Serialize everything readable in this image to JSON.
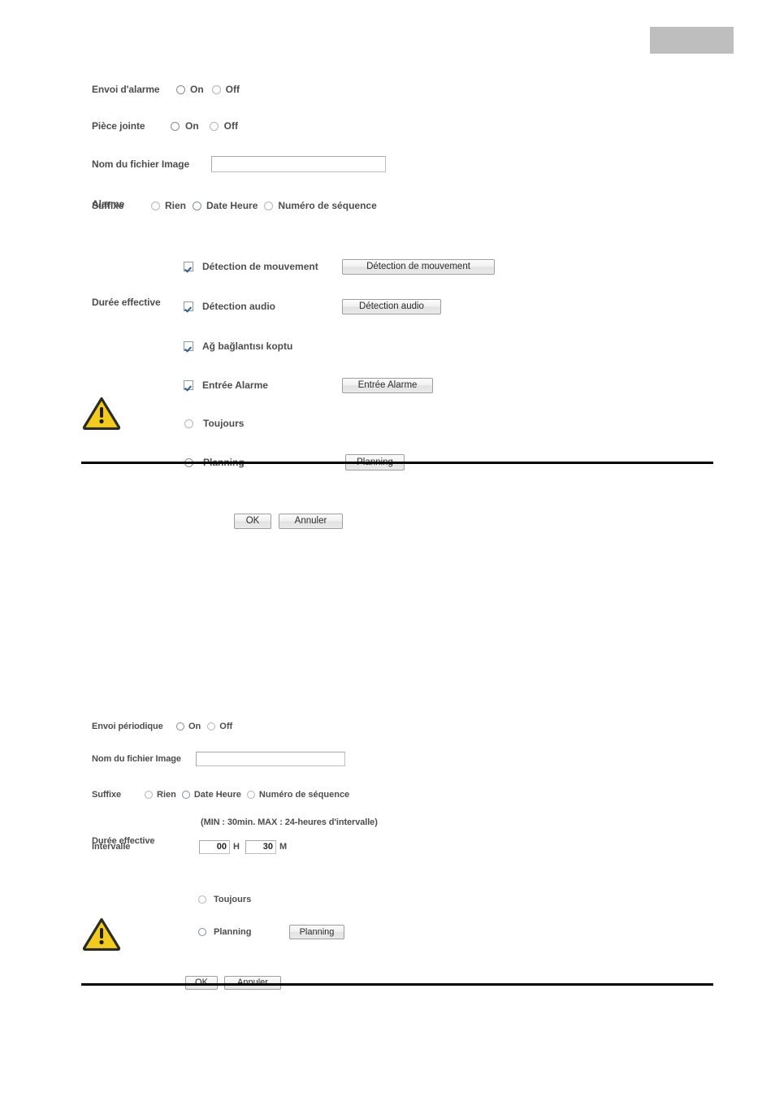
{
  "header": {
    "block_color": "#bebebe"
  },
  "panel_alarm": {
    "envoi": {
      "label": "Envoi d'alarme",
      "on_label": "On",
      "off_label": "Off",
      "selected": "On"
    },
    "piece_jointe": {
      "label": "Pièce jointe",
      "on_label": "On",
      "off_label": "Off",
      "selected": "On"
    },
    "nom_fichier": {
      "label": "Nom du fichier Image",
      "value": "",
      "placeholder": ""
    },
    "suffixe": {
      "label": "Suffixe",
      "options": [
        "Rien",
        "Date Heure",
        "Numéro de séquence"
      ],
      "selected": "Date Heure"
    },
    "alarme": {
      "label": "Alarme",
      "items": [
        {
          "label": "Détection de mouvement",
          "checked": true,
          "button": "Détection de mouvement"
        },
        {
          "label": "Détection audio",
          "checked": true,
          "button": "Détection audio"
        },
        {
          "label": "Ağ bağlantısı koptu",
          "checked": true,
          "button": null
        },
        {
          "label": "Entrée Alarme",
          "checked": true,
          "button": "Entrée Alarme"
        }
      ]
    },
    "duree": {
      "label": "Durée effective",
      "options": [
        "Toujours",
        "Planning"
      ],
      "selected": "Planning",
      "button": "Planning"
    },
    "actions": {
      "ok": "OK",
      "cancel": "Annuler"
    },
    "warning_icon": "warning-triangle-icon"
  },
  "panel_periodic": {
    "envoi": {
      "label": "Envoi périodique",
      "on_label": "On",
      "off_label": "Off",
      "selected": "On"
    },
    "nom_fichier": {
      "label": "Nom du fichier Image",
      "value": "",
      "placeholder": ""
    },
    "suffixe": {
      "label": "Suffixe",
      "options": [
        "Rien",
        "Date Heure",
        "Numéro de séquence"
      ],
      "selected": "Date Heure"
    },
    "intervalle": {
      "label": "Intervalle",
      "hours_value": "00",
      "hours_unit": "H",
      "minutes_value": "30",
      "minutes_unit": "M",
      "note": "(MIN : 30min. MAX : 24-heures d'intervalle)"
    },
    "duree": {
      "label": "Durée effective",
      "options": [
        "Toujours",
        "Planning"
      ],
      "selected": "Planning",
      "button": "Planning"
    },
    "actions": {
      "ok": "OK",
      "cancel": "Annuler"
    },
    "warning_icon": "warning-triangle-icon"
  }
}
